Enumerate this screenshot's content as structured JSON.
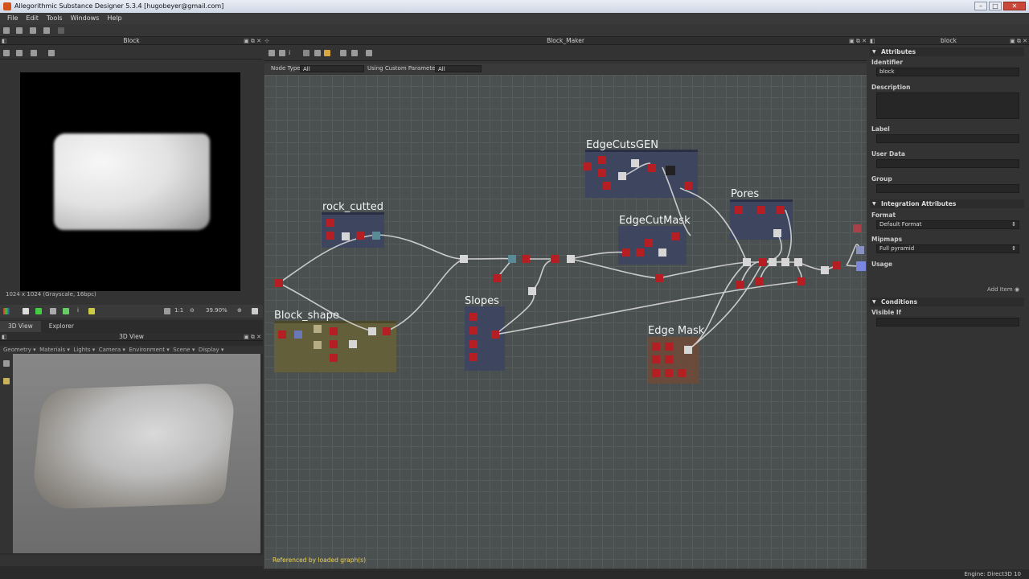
{
  "window": {
    "title": "Allegorithmic Substance Designer 5.3.4 [hugobeyer@gmail.com]",
    "buttons": [
      "–",
      "□",
      "✕"
    ]
  },
  "menu": [
    "File",
    "Edit",
    "Tools",
    "Windows",
    "Help"
  ],
  "left_panel": {
    "header": "Block",
    "image_info": "1024 x 1024 (Grayscale, 16bpc)",
    "zoom": "39.90%",
    "ratio": "1:1"
  },
  "tabs": [
    "3D View",
    "Explorer"
  ],
  "view3d": {
    "header": "3D View",
    "menu": [
      "Geometry ▾",
      "Materials ▾",
      "Lights ▾",
      "Camera ▾",
      "Environment ▾",
      "Scene ▾",
      "Display ▾"
    ]
  },
  "graph": {
    "header": "Block_Maker",
    "filter": {
      "node_type_label": "Node Type",
      "node_type_value": "All",
      "custom_params_label": "Using Custom Parameters",
      "custom_params_value": "All"
    },
    "frames": [
      {
        "label": "rock_cutted"
      },
      {
        "label": "Block_shape"
      },
      {
        "label": "Slopes"
      },
      {
        "label": "EdgeCutsGEN"
      },
      {
        "label": "EdgeCutMask"
      },
      {
        "label": "Pores"
      },
      {
        "label": "Edge Mask"
      }
    ],
    "referenced": "Referenced by loaded graph(s)"
  },
  "right_panel": {
    "header": "block",
    "attributes_title": "Attributes",
    "identifier_label": "Identifier",
    "identifier_value": "block",
    "description_label": "Description",
    "label_label": "Label",
    "userdata_label": "User Data",
    "group_label": "Group",
    "integration_title": "Integration Attributes",
    "format_label": "Format",
    "format_value": "Default Format",
    "mipmaps_label": "Mipmaps",
    "mipmaps_value": "Full pyramid",
    "usage_label": "Usage",
    "add_item": "Add Item",
    "conditions_title": "Conditions",
    "visible_if_label": "Visible If"
  },
  "status": {
    "engine": "Engine: Direct3D 10"
  }
}
